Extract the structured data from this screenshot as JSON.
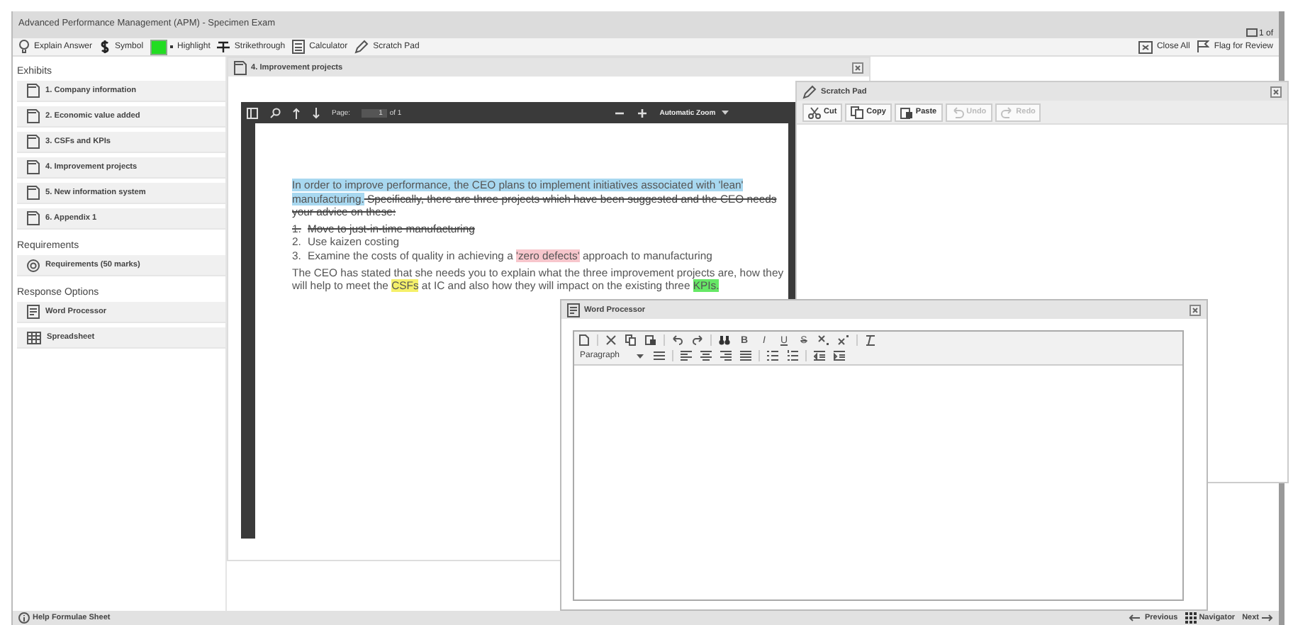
{
  "window": {
    "title": "Advanced Performance Management (APM) - Specimen Exam",
    "counter": "1 of"
  },
  "toolbar": {
    "left": [
      {
        "kind": "bulb",
        "label": "Explain Answer"
      },
      {
        "kind": "dollar",
        "label": "Symbol"
      },
      {
        "kind": "swatch",
        "label": "Highlight",
        "color": "#22dd22"
      },
      {
        "kind": "strike",
        "label": "Strikethrough"
      },
      {
        "kind": "calc",
        "label": "Calculator"
      },
      {
        "kind": "pencil",
        "label": "Scratch Pad"
      }
    ],
    "right": [
      {
        "kind": "closeall",
        "label": "Close All"
      },
      {
        "kind": "flag",
        "label": "Flag for Review"
      }
    ]
  },
  "sidebar": {
    "sections": [
      {
        "heading": "Exhibits",
        "items": [
          {
            "kind": "doc",
            "label": "1. Company information"
          },
          {
            "kind": "doc",
            "label": "2. Economic value added"
          },
          {
            "kind": "doc",
            "label": "3. CSFs and KPIs"
          },
          {
            "kind": "doc",
            "label": "4. Improvement projects"
          },
          {
            "kind": "doc",
            "label": "5. New information system"
          },
          {
            "kind": "doc",
            "label": "6. Appendix 1"
          }
        ]
      },
      {
        "heading": "Requirements",
        "items": [
          {
            "kind": "target",
            "label": "Requirements (50 marks)"
          }
        ]
      },
      {
        "heading": "Response Options",
        "items": [
          {
            "kind": "wp",
            "label": "Word Processor"
          },
          {
            "kind": "grid",
            "label": "Spreadsheet"
          }
        ]
      }
    ]
  },
  "exhibit": {
    "title": "4. Improvement projects",
    "viewer": {
      "page_label": "Page:",
      "page": "1",
      "page_count": "of 1",
      "zoom": "Automatic Zoom"
    },
    "paragraphs": [
      {
        "runs": [
          {
            "text": "In order to improve performance, the CEO plans to implement initiatives associated with 'lean' manufacturing.",
            "struck": false,
            "color": "#a8d8f0"
          },
          {
            "text": " Specifically, there are three projects which have been suggested and the CEO needs your advice on these:",
            "struck": true
          }
        ]
      }
    ],
    "list": [
      {
        "number": "1.",
        "struck": true,
        "runs": [
          {
            "text": "Move to just-in-time manufacturing",
            "struck": true
          }
        ]
      },
      {
        "number": "2.",
        "struck": false,
        "runs": [
          {
            "text": "Use kaizen costing",
            "struck": false
          }
        ]
      },
      {
        "number": "3.",
        "struck": false,
        "runs": [
          {
            "text": "Examine the costs of quality in achieving a ",
            "struck": false
          },
          {
            "text": "'zero defects'",
            "struck": false,
            "color": "#f7c6cc"
          },
          {
            "text": " approach to manufacturing",
            "struck": false
          }
        ]
      }
    ],
    "closing": {
      "runs": [
        {
          "text": "The CEO has stated that she needs you to explain what the three improvement projects are, how they will help to meet the ",
          "struck": false
        },
        {
          "text": "CSFs",
          "struck": false,
          "color": "#f5f06a"
        },
        {
          "text": " at IC and also how they will impact on the existing three ",
          "struck": false
        },
        {
          "text": "KPIs.",
          "struck": false,
          "color": "#66e866"
        }
      ]
    }
  },
  "scratch_pad": {
    "title": "Scratch Pad",
    "buttons": [
      {
        "kind": "cut",
        "label": "Cut",
        "disabled": false
      },
      {
        "kind": "copy",
        "label": "Copy",
        "disabled": false
      },
      {
        "kind": "paste",
        "label": "Paste",
        "disabled": false
      },
      {
        "kind": "undo",
        "label": "Undo",
        "disabled": true
      },
      {
        "kind": "redo",
        "label": "Redo",
        "disabled": true
      }
    ]
  },
  "word_processor": {
    "title": "Word Processor",
    "format_letters": [
      "B",
      "I",
      "U",
      "S"
    ],
    "block_format": "Paragraph"
  },
  "status_bar": {
    "left": "Help Formulae Sheet",
    "right": [
      {
        "kind": "prev",
        "label": "Previous"
      },
      {
        "kind": "nav",
        "label": "Navigator"
      },
      {
        "kind": "next",
        "label": "Next"
      }
    ]
  }
}
